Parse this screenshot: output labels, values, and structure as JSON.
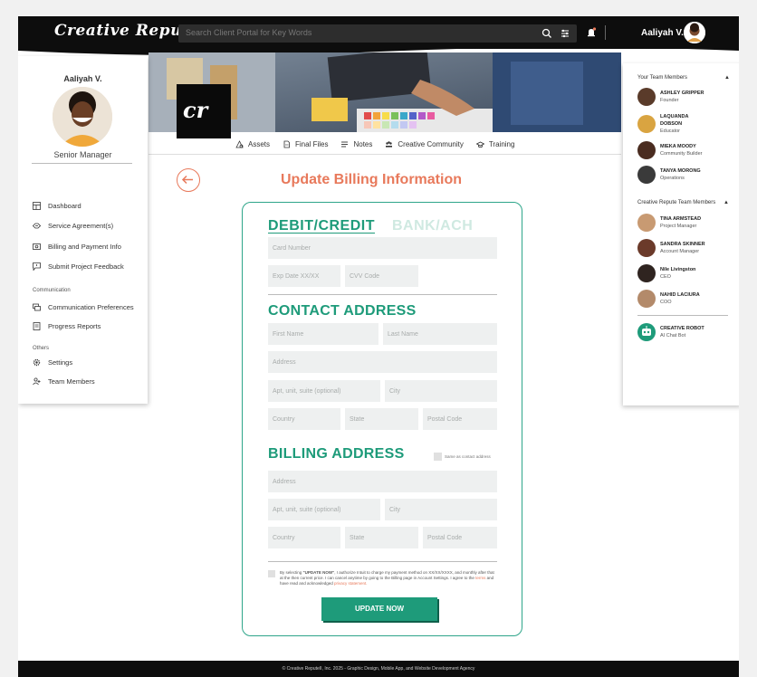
{
  "header": {
    "logo": "Creative Repute",
    "search_placeholder": "Search Client Portal for Key Words",
    "user_name": "Aaliyah V."
  },
  "profile": {
    "name": "Aaliyah V.",
    "role": "Senior Manager"
  },
  "sidebar": {
    "items": [
      {
        "label": "Dashboard",
        "icon": "dashboard-icon"
      },
      {
        "label": "Service Agreement(s)",
        "icon": "handshake-icon"
      },
      {
        "label": "Billing and Payment Info",
        "icon": "billing-icon"
      },
      {
        "label": "Submit Project Feedback",
        "icon": "feedback-icon"
      }
    ],
    "group_communication": "Communication",
    "communication_items": [
      {
        "label": "Communication Preferences",
        "icon": "chat-icon"
      },
      {
        "label": "Progress Reports",
        "icon": "report-icon"
      }
    ],
    "group_others": "Others",
    "other_items": [
      {
        "label": "Settings",
        "icon": "gear-icon"
      },
      {
        "label": "Team Members",
        "icon": "add-user-icon"
      }
    ]
  },
  "banner": {
    "logo_text": "cr"
  },
  "tabs": [
    {
      "label": "Assets"
    },
    {
      "label": "Final Files"
    },
    {
      "label": "Notes"
    },
    {
      "label": "Creative Community"
    },
    {
      "label": "Training"
    }
  ],
  "team": {
    "title": "Your Team Members",
    "members": [
      {
        "name": "ASHLEY GRIPPER",
        "role": "Founder",
        "color": "#5a3b2a"
      },
      {
        "name": "LAQUANDA DOBSON",
        "role": "Educator",
        "color": "#d9a441"
      },
      {
        "name": "MIEKA MOODY",
        "role": "Community Builder",
        "color": "#4a2c20"
      },
      {
        "name": "TANYA MORONG",
        "role": "Operations",
        "color": "#3a3a3a"
      }
    ],
    "cr_title": "Creative Repute Team Members",
    "cr_members": [
      {
        "name": "TINA ARMSTEAD",
        "role": "Project Manager",
        "color": "#c89a72"
      },
      {
        "name": "SANDRA SKINNER",
        "role": "Account Manager",
        "color": "#6b3a2a"
      },
      {
        "name": "Nile Livingston",
        "role": "CEO",
        "color": "#2f2420"
      },
      {
        "name": "NAHID LACIURA",
        "role": "COO",
        "color": "#b38a6a"
      }
    ],
    "bot": {
      "name": "CREATIVE ROBOT",
      "role": "AI Chat Bot",
      "color": "#1e9b7a"
    }
  },
  "main": {
    "title": "Update Billing Information",
    "tab_active": "DEBIT/CREDIT",
    "tab_inactive": "BANK/ACH",
    "card_number_ph": "Card Number",
    "exp_ph": "Exp Date XX/XX",
    "cvv_ph": "CVV Code",
    "contact_title": "CONTACT ADDRESS",
    "first_name_ph": "First Name",
    "last_name_ph": "Last Name",
    "address_ph": "Address",
    "apt_ph": "Apt, unit, suite (optional)",
    "city_ph": "City",
    "country_ph": "Country",
    "state_ph": "State",
    "postal_ph": "Postal Code",
    "billing_title": "BILLING ADDRESS",
    "same_as_contact": "Same as contact address",
    "agree_pre": "By selecting ",
    "agree_bold": "\"UPDATE NOW\"",
    "agree_mid": ", I authorize Intuit to charge my payment method on XX/XX/XXXX, and monthly after that at the then current price. I can cancel anytime by going to the Billing page in Account Settings. I agree to the ",
    "agree_terms": "terms",
    "agree_mid2": " and have read and acknowledged ",
    "agree_privacy": "privacy statement.",
    "button": "UPDATE NOW"
  },
  "footer": {
    "text": "© Creative ReputeII, Inc. 2025 - Graphic Design, Mobile App, and Website Development Agency"
  },
  "colors": {
    "accent_green": "#1e9b7a",
    "accent_orange": "#e8795b",
    "dark": "#0d0d0d"
  }
}
